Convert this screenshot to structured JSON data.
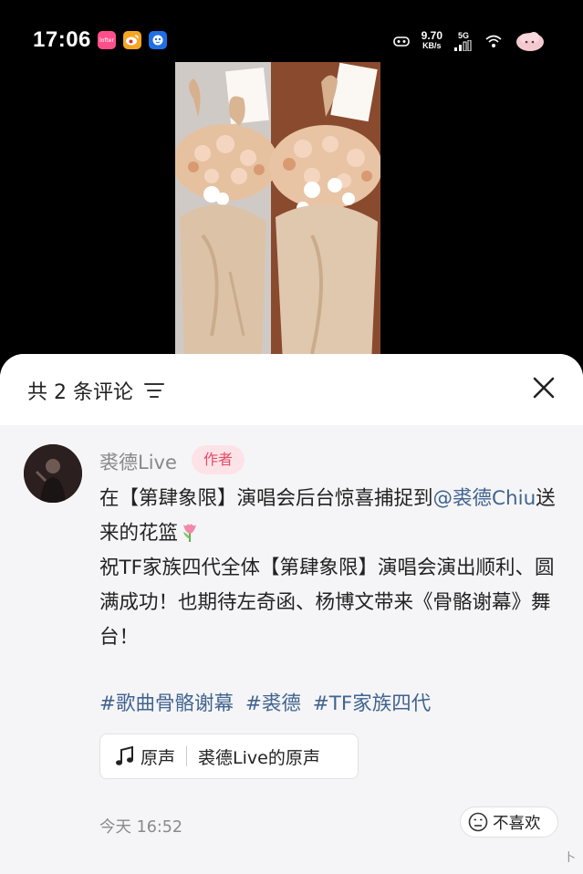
{
  "status_bar": {
    "time": "17:06",
    "apps": [
      {
        "icon": "lofter-app-icon",
        "label": "lofter",
        "color": "#ff4f8b"
      },
      {
        "icon": "weibo-app-icon",
        "label": "微",
        "color": "#f5a623"
      },
      {
        "icon": "bird-app-icon",
        "label": "•",
        "color": "#1f6fe5"
      }
    ],
    "net_speed_value": "9.70",
    "net_speed_unit": "KB/s",
    "signal": "5G"
  },
  "photo": {
    "subject": "two flower baskets with white orchids and peach roses"
  },
  "sheet": {
    "title": "共 2 条评论",
    "close_icon": "close-icon",
    "filter_icon": "filter-icon"
  },
  "comment": {
    "author": "裘德Live",
    "badge": "作者",
    "line1_prefix": "在【第肆象限】演唱会后台惊喜捕捉到",
    "mention": "@裘德Chiu",
    "line1_suffix": "送来的花篮",
    "paragraph2": "祝TF家族四代全体【第肆象限】演唱会演出顺利、圆满成功！也期待左奇函、杨博文带来《骨骼谢幕》舞台！",
    "tags": [
      "#歌曲骨骼谢幕",
      "#裘德",
      "#TF家族四代"
    ],
    "audio_label": "原声",
    "audio_source": "裘德Live的原声",
    "timestamp": "今天 16:52",
    "dislike_label": "不喜欢"
  },
  "watermark": "卜"
}
